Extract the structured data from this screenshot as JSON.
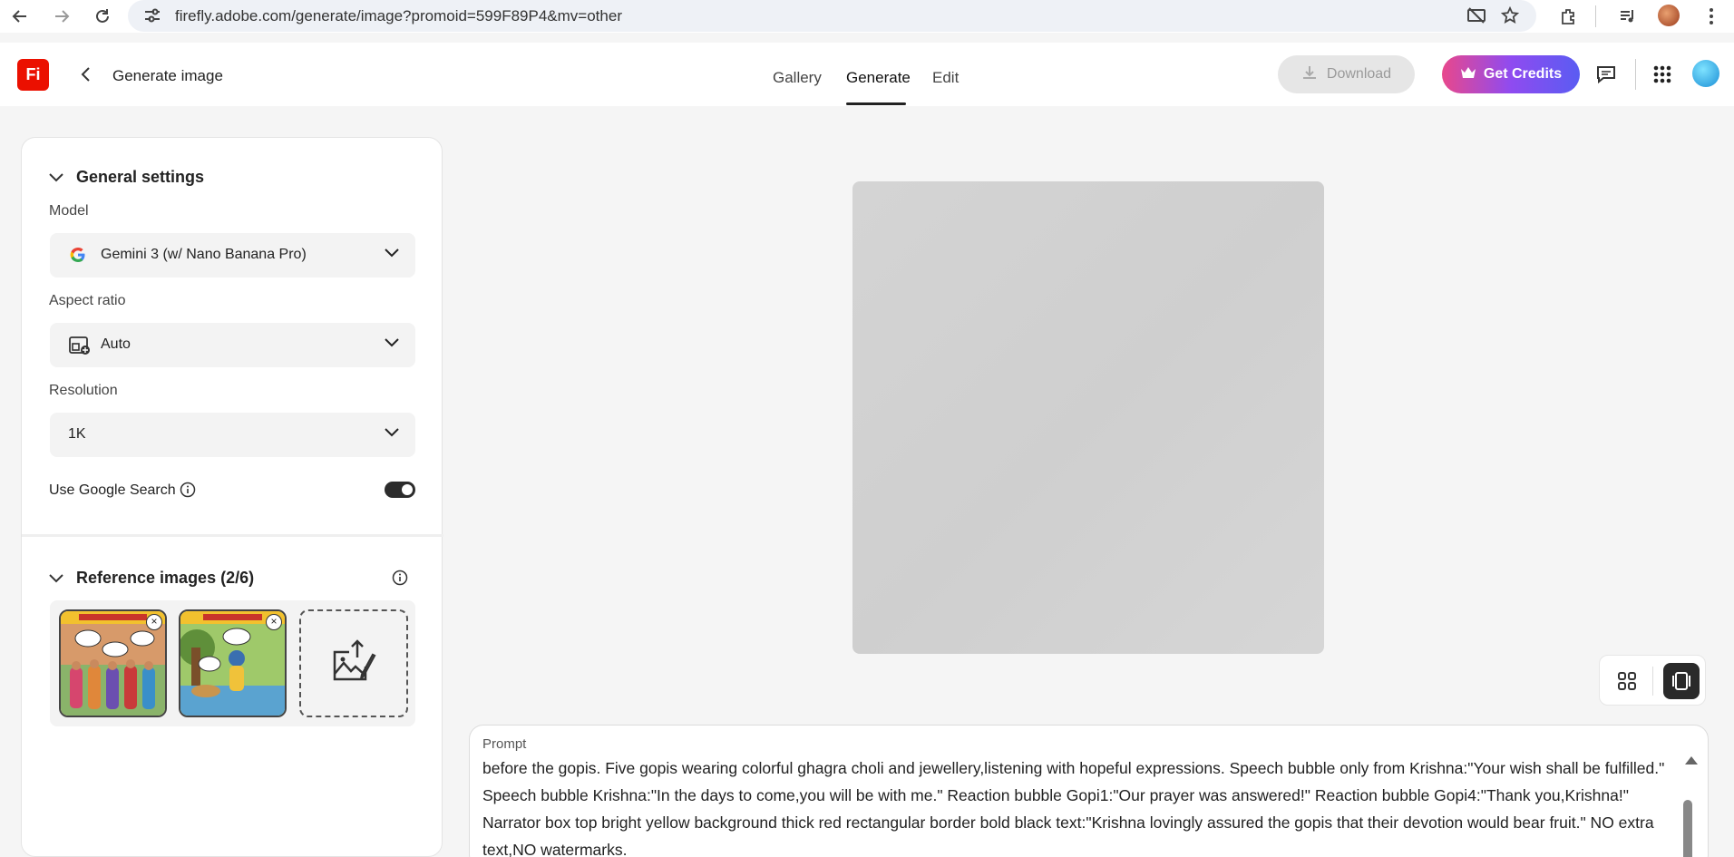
{
  "browser": {
    "url": "firefly.adobe.com/generate/image?promoid=599F89P4&mv=other"
  },
  "header": {
    "logo_text": "Fi",
    "title": "Generate image",
    "tabs": [
      {
        "label": "Gallery"
      },
      {
        "label": "Generate",
        "active": true
      },
      {
        "label": "Edit"
      }
    ],
    "download_label": "Download",
    "credits_label": "Get Credits",
    "credits_gradient": [
      "#e8488c",
      "#8f4bf0",
      "#5a5cf2"
    ],
    "logo_color": "#eb1000"
  },
  "settings": {
    "section_title": "General settings",
    "model_label": "Model",
    "model_value": "Gemini 3 (w/ Nano Banana Pro)",
    "aspect_label": "Aspect ratio",
    "aspect_value": "Auto",
    "resolution_label": "Resolution",
    "resolution_value": "1K",
    "google_search_label": "Use Google Search",
    "google_search_on": true
  },
  "reference": {
    "section_title": "Reference images (2/6)",
    "images": [
      {
        "name": "comic-gopis-reference"
      },
      {
        "name": "comic-krishna-river-reference"
      }
    ]
  },
  "prompt": {
    "label": "Prompt",
    "text": "before the gopis. Five gopis wearing colorful ghagra choli and jewellery,listening with hopeful expressions. Speech bubble only from Krishna:\"Your wish shall be fulfilled.\" Speech bubble Krishna:\"In the days to come,you will be with me.\" Reaction bubble Gopi1:\"Our prayer was answered!\" Reaction bubble Gopi4:\"Thank you,Krishna!\" Narrator box top bright yellow background thick red rectangular border bold black text:\"Krishna lovingly assured the gopis that their devotion would bear fruit.\" NO extra text,NO watermarks."
  },
  "icons": {
    "browser": [
      "back-arrow-icon",
      "forward-arrow-icon",
      "reload-icon",
      "site-info-icon",
      "no-camera-icon",
      "star-icon",
      "extensions-icon",
      "media-icon",
      "profile-avatar-icon",
      "more-vert-icon"
    ],
    "header": [
      "chevron-left-icon",
      "download-icon",
      "crown-icon",
      "feedback-icon",
      "apps-grid-icon",
      "account-avatar-icon"
    ]
  }
}
